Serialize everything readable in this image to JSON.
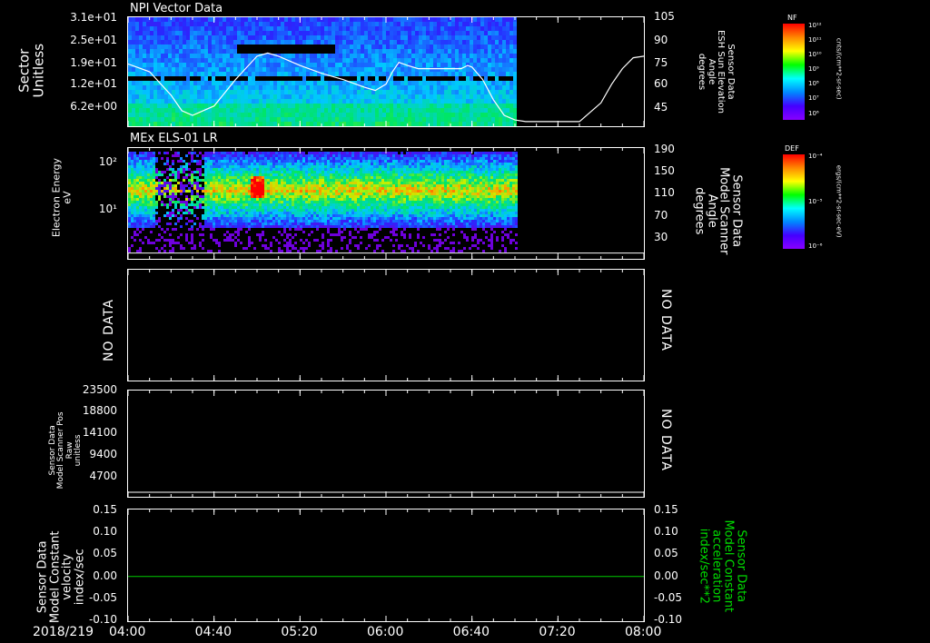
{
  "time_axis": {
    "date": "2018/219",
    "ticks": [
      "04:00",
      "04:40",
      "05:20",
      "06:00",
      "06:40",
      "07:20",
      "08:00"
    ],
    "tick_minutes": [
      240,
      280,
      320,
      360,
      400,
      440,
      480
    ],
    "range_minutes": [
      240,
      480
    ]
  },
  "panel1": {
    "title": "NPI Vector Data",
    "ylabel_line1": "Sector",
    "ylabel_line2": "Unitless",
    "yticks": [
      "3.1e+01",
      "2.5e+01",
      "1.9e+01",
      "1.2e+01",
      "6.2e+00"
    ],
    "right_label_line1": "Sensor Data",
    "right_label_line2": "ESH Sun Elevation",
    "right_label_line3": "Angle",
    "right_label_line4": "degrees",
    "right_ticks": [
      "105",
      "90",
      "75",
      "60",
      "45"
    ],
    "colorbar": {
      "name": "NF",
      "unit": "cnts/(cm**2-sr-sec)",
      "ticks": [
        "10¹²",
        "10¹¹",
        "10¹⁰",
        "10⁹",
        "10⁸",
        "10⁷",
        "10⁶"
      ]
    }
  },
  "panel2": {
    "title": "MEx ELS-01 LR",
    "ylabel_line1": "Electron Energy",
    "ylabel_line2": "eV",
    "yticks": [
      "10²",
      "10¹"
    ],
    "right_label_line1": "Sensor Data",
    "right_label_line2": "Model Scanner",
    "right_label_line3": "Angle",
    "right_label_line4": "degrees",
    "right_ticks": [
      "190",
      "150",
      "110",
      "70",
      "30"
    ],
    "colorbar": {
      "name": "DEF",
      "unit": "ergs/(cm**2-sr-sec-eV)",
      "ticks": [
        "10⁻⁴",
        "10⁻⁵",
        "10⁻⁶"
      ]
    }
  },
  "panel3": {
    "left_nodata": "NO DATA",
    "right_nodata": "NO DATA"
  },
  "panel4": {
    "ylabel_line1": "Sensor Data",
    "ylabel_line2": "Model Scanner Pos",
    "ylabel_line3": "Raw",
    "ylabel_line4": "unitless",
    "yticks": [
      "23500",
      "18800",
      "14100",
      "9400",
      "4700"
    ],
    "right_nodata": "NO DATA"
  },
  "panel5": {
    "ylabel_line1": "Sensor Data",
    "ylabel_line2": "Model Constant",
    "ylabel_line3": "velocity",
    "ylabel_line4": "index/sec",
    "yticks": [
      "0.15",
      "0.10",
      "0.05",
      "0.00",
      "-0.05",
      "-0.10"
    ],
    "right_ticks": [
      "0.15",
      "0.10",
      "0.05",
      "0.00",
      "-0.05",
      "-0.10"
    ],
    "right_label_line1": "Sensor Data",
    "right_label_line2": "Model Constant",
    "right_label_line3": "acceleration",
    "right_label_line4": "index/sec**2",
    "line_color": "#00cc00"
  },
  "chart_data": [
    {
      "type": "heatmap",
      "title": "NPI Vector Data",
      "ylabel": "Sector Unitless",
      "colorbar": "NF cnts/(cm**2-sr-sec)",
      "overlay_line": {
        "name": "ESH Sun Elevation Angle",
        "axis": "right",
        "ylim": [
          35,
          105
        ],
        "x_minutes": [
          240,
          250,
          260,
          265,
          270,
          280,
          290,
          300,
          305,
          310,
          320,
          330,
          340,
          350,
          355,
          360,
          363,
          366,
          370,
          375,
          380,
          385,
          390,
          395,
          398,
          400,
          405,
          410,
          415,
          420,
          425,
          430,
          440,
          450,
          460,
          465,
          470,
          475,
          480
        ],
        "y": [
          75,
          70,
          55,
          45,
          42,
          48,
          65,
          80,
          82,
          80,
          74,
          69,
          65,
          60,
          58,
          62,
          70,
          76,
          74,
          72,
          72,
          72,
          72,
          72,
          74,
          73,
          65,
          52,
          42,
          39,
          38,
          38,
          38,
          38,
          50,
          62,
          72,
          79,
          80
        ]
      },
      "data_end_minutes": 420
    },
    {
      "type": "heatmap",
      "title": "MEx ELS-01 LR",
      "ylabel": "Electron Energy eV",
      "colorbar": "DEF ergs/(cm**2-sr-sec-eV)",
      "data_end_minutes": 421,
      "overlay_line": {
        "name": "Model Scanner Angle",
        "axis": "right",
        "ylim": [
          0,
          190
        ],
        "value": 10
      }
    },
    {
      "type": "line",
      "ylabel": "Model Constant velocity index/sec",
      "ylim": [
        -0.1,
        0.15
      ],
      "x_minutes": [
        240,
        480
      ],
      "y": [
        0.0,
        0.0
      ]
    }
  ]
}
